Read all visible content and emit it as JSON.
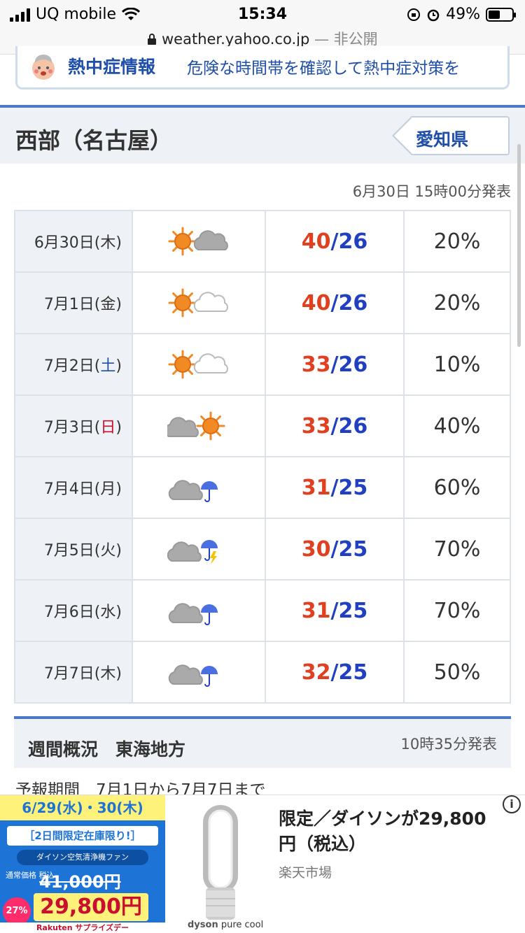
{
  "status_bar": {
    "carrier": "UQ mobile",
    "time": "15:34",
    "battery": "49%",
    "battery_level": 0.49,
    "url": "weather.yahoo.co.jp",
    "privacy": "— 非公開"
  },
  "heat_banner": {
    "title": "熱中症情報",
    "text": "危険な時間帯を確認して熱中症対策を"
  },
  "region": {
    "title": "西部（名古屋）",
    "prefecture_button": "愛知県"
  },
  "issued": "6月30日 15時00分発表",
  "forecast": [
    {
      "date_pre": "6月30日(",
      "weekday": "木",
      "date_post": ")",
      "weekday_type": "normal",
      "icon": "sunny-then-cloudy",
      "hi": "40",
      "lo": "26",
      "pop": "20%"
    },
    {
      "date_pre": "7月1日(",
      "weekday": "金",
      "date_post": ")",
      "weekday_type": "normal",
      "icon": "sunny-partly-cloudy",
      "hi": "40",
      "lo": "26",
      "pop": "20%"
    },
    {
      "date_pre": "7月2日(",
      "weekday": "土",
      "date_post": ")",
      "weekday_type": "sat",
      "icon": "sunny-partly-cloudy",
      "hi": "33",
      "lo": "26",
      "pop": "10%"
    },
    {
      "date_pre": "7月3日(",
      "weekday": "日",
      "date_post": ")",
      "weekday_type": "sun",
      "icon": "cloudy-then-sunny",
      "hi": "33",
      "lo": "26",
      "pop": "40%"
    },
    {
      "date_pre": "7月4日(",
      "weekday": "月",
      "date_post": ")",
      "weekday_type": "normal",
      "icon": "cloudy-with-rain",
      "hi": "31",
      "lo": "25",
      "pop": "60%"
    },
    {
      "date_pre": "7月5日(",
      "weekday": "火",
      "date_post": ")",
      "weekday_type": "normal",
      "icon": "cloudy-with-thunder-rain",
      "hi": "30",
      "lo": "25",
      "pop": "70%"
    },
    {
      "date_pre": "7月6日(",
      "weekday": "水",
      "date_post": ")",
      "weekday_type": "normal",
      "icon": "cloudy-with-rain",
      "hi": "31",
      "lo": "25",
      "pop": "70%"
    },
    {
      "date_pre": "7月7日(",
      "weekday": "木",
      "date_post": ")",
      "weekday_type": "normal",
      "icon": "cloudy-with-rain",
      "hi": "32",
      "lo": "25",
      "pop": "50%"
    }
  ],
  "weekly": {
    "title": "週間概況　東海地方",
    "issued": "10時35分発表",
    "period": "予報期間　7月1日から7月7日まで"
  },
  "ad": {
    "banner_dates": "6/29(水)・30(木)",
    "banner_line1": "［2日間限定在庫限り!］",
    "banner_line2": "ダイソン空気清浄機ファン",
    "banner_regular_label": "通常価格 税込",
    "banner_regular_price": "41,000円",
    "banner_discount": "27%",
    "banner_sale_price": "29,800円",
    "banner_brand": "Rakuten サプライズデー",
    "product_brand_a": "dyson",
    "product_brand_b": " pure cool",
    "title": "限定／ダイソンが29,800円（税込）",
    "source": "楽天市場",
    "info_icon": "i"
  },
  "colors": {
    "accent": "#4a78c8",
    "link": "#1f4fa8",
    "high_temp": "#e04020",
    "low_temp": "#2040c0",
    "header_bg": "#eef2f7"
  }
}
